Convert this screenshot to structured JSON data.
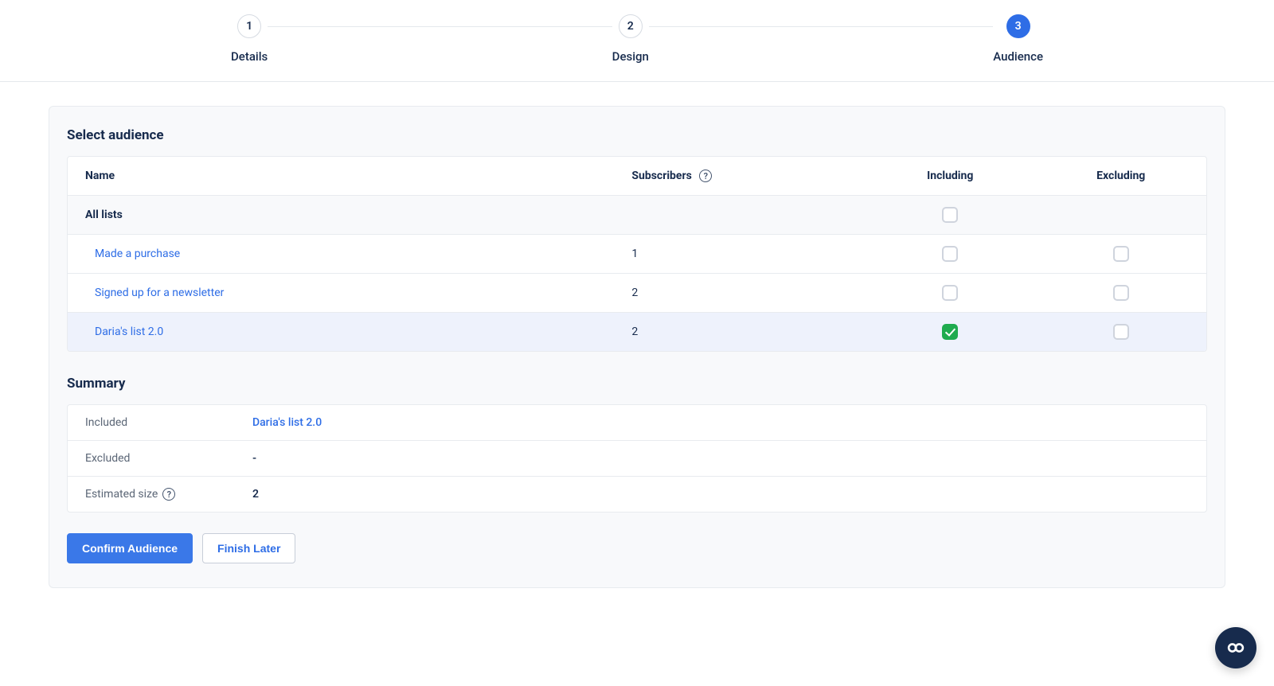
{
  "stepper": {
    "steps": [
      {
        "num": "1",
        "label": "Details"
      },
      {
        "num": "2",
        "label": "Design"
      },
      {
        "num": "3",
        "label": "Audience"
      }
    ],
    "activeIndex": 2
  },
  "selectAudience": {
    "title": "Select audience",
    "columns": {
      "name": "Name",
      "subscribers": "Subscribers",
      "including": "Including",
      "excluding": "Excluding"
    },
    "allListsLabel": "All lists",
    "rows": [
      {
        "name": "Made a purchase",
        "subscribers": "1",
        "including": false,
        "excluding": false,
        "selected": false
      },
      {
        "name": "Signed up for a newsletter",
        "subscribers": "2",
        "including": false,
        "excluding": false,
        "selected": false
      },
      {
        "name": "Daria's list 2.0",
        "subscribers": "2",
        "including": true,
        "excluding": false,
        "selected": true
      }
    ]
  },
  "summary": {
    "title": "Summary",
    "includedLabel": "Included",
    "includedValue": "Daria's list 2.0",
    "excludedLabel": "Excluded",
    "excludedValue": "-",
    "estimatedLabel": "Estimated size",
    "estimatedValue": "2"
  },
  "actions": {
    "confirm": "Confirm Audience",
    "finishLater": "Finish Later"
  }
}
